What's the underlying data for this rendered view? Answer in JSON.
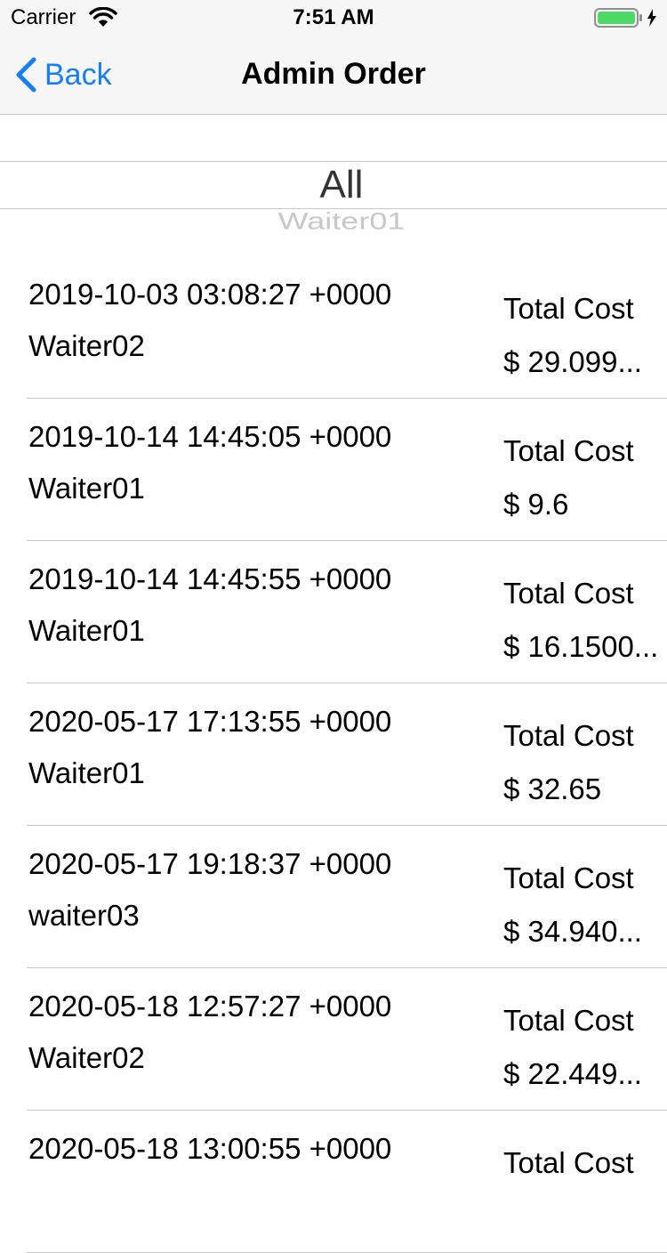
{
  "status_bar": {
    "carrier": "Carrier",
    "time": "7:51 AM",
    "battery_color": "#4cd964"
  },
  "nav": {
    "back_label": "Back",
    "title": "Admin Order",
    "tint_color": "#147efb"
  },
  "picker": {
    "selected": "All",
    "next_option": "Waiter01"
  },
  "orders": [
    {
      "date": "2019-10-03 03:08:27 +0000",
      "waiter": "Waiter02",
      "cost_label": "Total Cost",
      "cost": "$ 29.099..."
    },
    {
      "date": "2019-10-14 14:45:05 +0000",
      "waiter": "Waiter01",
      "cost_label": "Total Cost",
      "cost": "$ 9.6"
    },
    {
      "date": "2019-10-14 14:45:55 +0000",
      "waiter": "Waiter01",
      "cost_label": "Total Cost",
      "cost": "$ 16.1500..."
    },
    {
      "date": "2020-05-17 17:13:55 +0000",
      "waiter": "Waiter01",
      "cost_label": "Total Cost",
      "cost": "$ 32.65"
    },
    {
      "date": "2020-05-17 19:18:37 +0000",
      "waiter": "waiter03",
      "cost_label": "Total Cost",
      "cost": "$ 34.940..."
    },
    {
      "date": "2020-05-18 12:57:27 +0000",
      "waiter": "Waiter02",
      "cost_label": "Total Cost",
      "cost": "$ 22.449..."
    },
    {
      "date": "2020-05-18 13:00:55 +0000",
      "waiter": "",
      "cost_label": "Total Cost",
      "cost": ""
    }
  ]
}
